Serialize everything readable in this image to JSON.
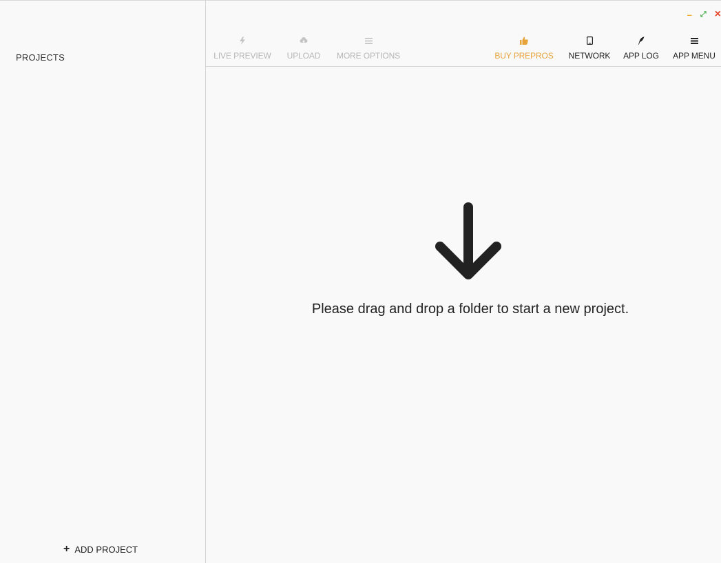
{
  "window": {
    "minimize_label": "–",
    "maximize_label": "⤢",
    "close_label": "×",
    "colors": {
      "minimize": "#f0a92f",
      "maximize": "#4caf50",
      "close": "#e8452c"
    }
  },
  "sidebar": {
    "title": "PROJECTS",
    "add_project_icon": "+",
    "add_project_label": "ADD PROJECT"
  },
  "toolbar": {
    "live_preview": {
      "label": "LIVE PREVIEW",
      "icon": "lightning-icon",
      "enabled": false
    },
    "upload": {
      "label": "UPLOAD",
      "icon": "cloud-upload-icon",
      "enabled": false
    },
    "more_options": {
      "label": "MORE OPTIONS",
      "icon": "menu-lines-icon",
      "enabled": false
    },
    "buy_prepros": {
      "label": "BUY PREPROS",
      "icon": "thumbs-up-icon",
      "enabled": true
    },
    "network": {
      "label": "NETWORK",
      "icon": "mobile-device-icon",
      "enabled": true
    },
    "app_log": {
      "label": "APP LOG",
      "icon": "feather-icon",
      "enabled": true
    },
    "app_menu": {
      "label": "APP MENU",
      "icon": "hamburger-icon",
      "enabled": true
    }
  },
  "main": {
    "drop_message": "Please drag and drop a folder to start a new project.",
    "drop_icon": "arrow-down-icon"
  },
  "colors": {
    "accent": "#e8a23a",
    "disabled_text": "#b6b6b6",
    "background": "#f9f9f9"
  }
}
